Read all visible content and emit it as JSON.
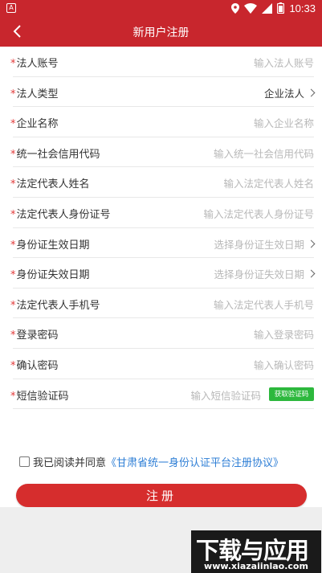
{
  "status_bar": {
    "left_icon": "A",
    "time": "10:33",
    "icons": [
      "location-icon",
      "wifi-icon",
      "signal-icon",
      "battery-icon"
    ]
  },
  "nav": {
    "title": "新用户注册",
    "back_icon": "chevron-left-icon"
  },
  "form": {
    "required_mark": "*",
    "rows": [
      {
        "label": "法人账号",
        "value": "输入法人账号",
        "type": "input"
      },
      {
        "label": "法人类型",
        "value": "企业法人",
        "type": "select"
      },
      {
        "label": "企业名称",
        "value": "输入企业名称",
        "type": "input"
      },
      {
        "label": "统一社会信用代码",
        "value": "输入统一社会信用代码",
        "type": "input"
      },
      {
        "label": "法定代表人姓名",
        "value": "输入法定代表人姓名",
        "type": "input"
      },
      {
        "label": "法定代表人身份证号",
        "value": "输入法定代表人身份证号",
        "type": "input"
      },
      {
        "label": "身份证生效日期",
        "value": "选择身份证生效日期",
        "type": "select"
      },
      {
        "label": "身份证失效日期",
        "value": "选择身份证失效日期",
        "type": "select"
      },
      {
        "label": "法定代表人手机号",
        "value": "输入法定代表人手机号",
        "type": "input"
      },
      {
        "label": "登录密码",
        "value": "输入登录密码",
        "type": "input"
      },
      {
        "label": "确认密码",
        "value": "输入确认密码",
        "type": "input"
      },
      {
        "label": "短信验证码",
        "value": "输入短信验证码",
        "type": "sms"
      }
    ],
    "sms_button": "获取验证码"
  },
  "agreement": {
    "text": "我已阅读并同意",
    "link": "《甘肃省统一身份认证平台注册协议》",
    "checked": false
  },
  "register_button": "注册",
  "watermark": {
    "title": "下载与应用",
    "url": "www.xiazaiinlao.com"
  },
  "colors": {
    "primary": "#c8262d",
    "button": "#d62d2d",
    "sms_button": "#2db83d",
    "link": "#2f7fd6",
    "placeholder": "#b8b8b8"
  }
}
